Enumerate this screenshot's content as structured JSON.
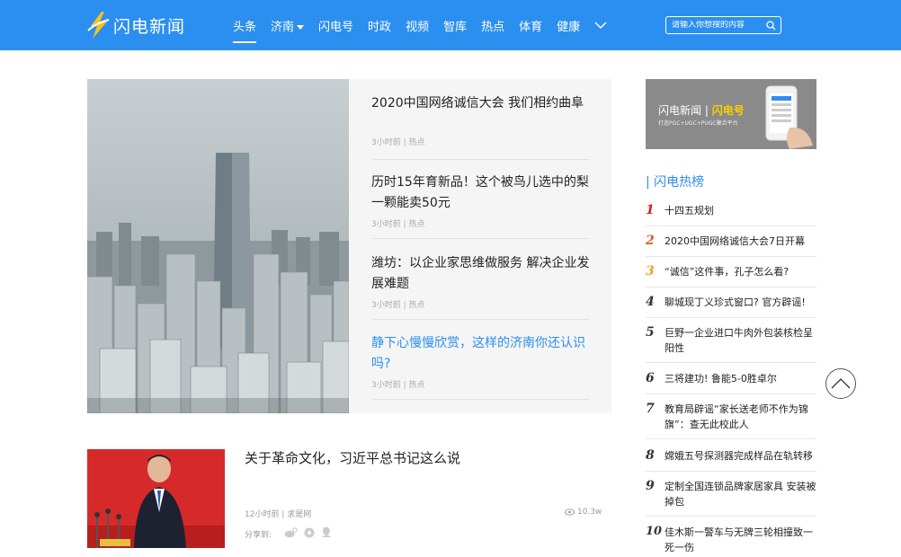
{
  "header": {
    "logo_text": "闪电新闻",
    "nav": [
      {
        "label": "头条"
      },
      {
        "label": "济南"
      },
      {
        "label": "闪电号"
      },
      {
        "label": "时政"
      },
      {
        "label": "视频"
      },
      {
        "label": "智库"
      },
      {
        "label": "热点"
      },
      {
        "label": "体育"
      },
      {
        "label": "健康"
      }
    ],
    "search_placeholder": "请输入你想搜的内容",
    "accent_color": "#2b8ff0"
  },
  "feature": {
    "items": [
      {
        "title": "2020中国网络诚信大会 我们相约曲阜",
        "meta": "3小时前 | 热点"
      },
      {
        "title": "历时15年育新品！这个被鸟儿选中的梨一颗能卖50元",
        "meta": "3小时前 | 热点"
      },
      {
        "title": "潍坊：以企业家思维做服务 解决企业发展难题",
        "meta": "3小时前 | 热点"
      },
      {
        "title": "静下心慢慢欣赏，这样的济南你还认识吗?",
        "meta": "3小时前 | 热点"
      }
    ]
  },
  "article2": {
    "title": "关于革命文化，习近平总书记这么说",
    "meta": "12小时前 | 求是网",
    "views": "10.3w",
    "share_label": "分享到:"
  },
  "sidebar": {
    "banner_brand": "闪电新闻",
    "banner_highlight": "闪电号",
    "banner_sub": "打造PGC+UGC+PUGC聚合平台",
    "hot_title": "| 闪电热榜",
    "hot": [
      {
        "rank": "1",
        "text": "十四五规划"
      },
      {
        "rank": "2",
        "text": "2020中国网络诚信大会7日开幕"
      },
      {
        "rank": "3",
        "text": "“诚信”这件事，孔子怎么看?"
      },
      {
        "rank": "4",
        "text": "聊城现丁义珍式窗口? 官方辟谣!"
      },
      {
        "rank": "5",
        "text": "巨野一企业进口牛肉外包装核检呈阳性"
      },
      {
        "rank": "6",
        "text": "三将建功! 鲁能5-0胜卓尔"
      },
      {
        "rank": "7",
        "text": "教育局辟谣“家长送老师不作为锦旗”：查无此校此人"
      },
      {
        "rank": "8",
        "text": "嫦娥五号探测器完成样品在轨转移"
      },
      {
        "rank": "9",
        "text": "定制全国连锁品牌家居家具 安装被掉包"
      },
      {
        "rank": "10",
        "text": "佳木斯一警车与无牌三轮相撞致一死一伤"
      }
    ]
  }
}
